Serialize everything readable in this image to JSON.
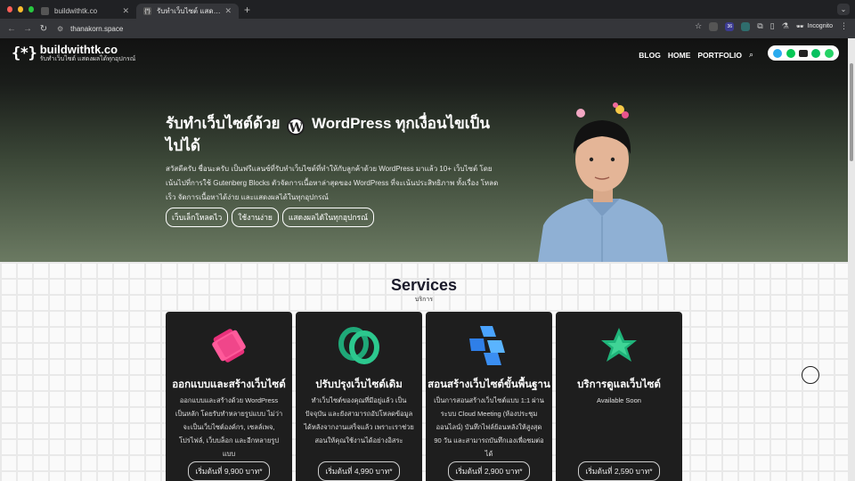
{
  "browser": {
    "tabs": [
      {
        "title": "buildwithtk.co",
        "active": false
      },
      {
        "title": "รับทำเว็บไซต์ แสดงผลได้ทุกอุปกรณ์",
        "active": true
      }
    ],
    "url": "thanakorn.space",
    "incognito_label": "Incognito",
    "badge_count": "36"
  },
  "site": {
    "logo_mark": "{*}",
    "logo_name": "buildwithtk.co",
    "logo_tagline": "รับทำเว็บไซต์ แสดงผลได้ทุกอุปกรณ์",
    "nav": [
      "BLOG",
      "HOME",
      "PORTFOLIO"
    ],
    "social_colors": [
      "#2AABEE",
      "#06C755",
      "#222222",
      "#07C160",
      "#25D366"
    ]
  },
  "hero": {
    "title_part1": "รับทำเว็บไซต์ด้วย",
    "wp_logo": "W",
    "title_part2": "WordPress ทุกเงื่อนไขเป็นไปได้",
    "description": "สวัสดีครับ ชื่อนะครับ เป็นฟรีแลนซ์ที่รับทำเว็บไซต์ที่ทำให้กับลูกค้าด้วย WordPress มาแล้ว 10+ เว็บไซต์ โดยเน้นไปที่การใช้ Gutenberg Blocks ตัวจัดการเนื้อหาล่าสุดของ WordPress ที่จะเน้นประสิทธิภาพ ทั้งเรื่อง โหลดเร็ว จัดการเนื้อหาได้ง่าย และแสดงผลได้ในทุกอุปกรณ์",
    "pills": [
      "เว็บเล็กโหลดไว",
      "ใช้งานง่าย",
      "แสดงผลได้ในทุกอุปกรณ์"
    ]
  },
  "services": {
    "title": "Services",
    "subtitle": "บริการ",
    "cards": [
      {
        "title": "ออกแบบและสร้างเว็บไซต์",
        "desc": "ออกแบบและสร้างด้วย WordPress เป็นหลัก โดยรับทำหลายรูปแบบ ไม่ว่าจะเป็นเว็บไซต์องค์กร, เซลล์เพจ, โปรไฟล์, เว็บบล็อก และอีกหลายรูปแบบ",
        "price": "เริ่มต้นที่ 9,900 บาท*",
        "icon": "pink-gear-icon"
      },
      {
        "title": "ปรับปรุงเว็บไซต์เดิม",
        "desc": "ทำเว็บไซต์ของคุณที่มีอยู่แล้ว เป็นปัจจุบัน และยังสามารถอัปโหลดข้อมูลได้หลังจากงานเสร็จแล้ว เพราะเราช่วยสอนให้คุณใช้งานได้อย่างอิสระ",
        "price": "เริ่มต้นที่ 4,990 บาท*",
        "icon": "green-knot-icon"
      },
      {
        "title": "สอนสร้างเว็บไซต์ขั้นพื้นฐาน",
        "desc": "เป็นการสอนสร้างเว็บไซต์แบบ 1:1 ผ่านระบบ Cloud Meeting (ห้องประชุมออนไลน์) บันทึกไฟล์ย้อนหลังให้สูงสุด 90 วัน และสามารถบันทึกเองเพื่อชมต่อได้",
        "price": "เริ่มต้นที่ 2,900 บาท*",
        "icon": "blue-cubes-icon"
      },
      {
        "title": "บริการดูแลเว็บไซต์",
        "desc": "Available Soon",
        "price": "เริ่มต้นที่ 2,590 บาท*",
        "icon": "green-star-icon"
      }
    ]
  }
}
